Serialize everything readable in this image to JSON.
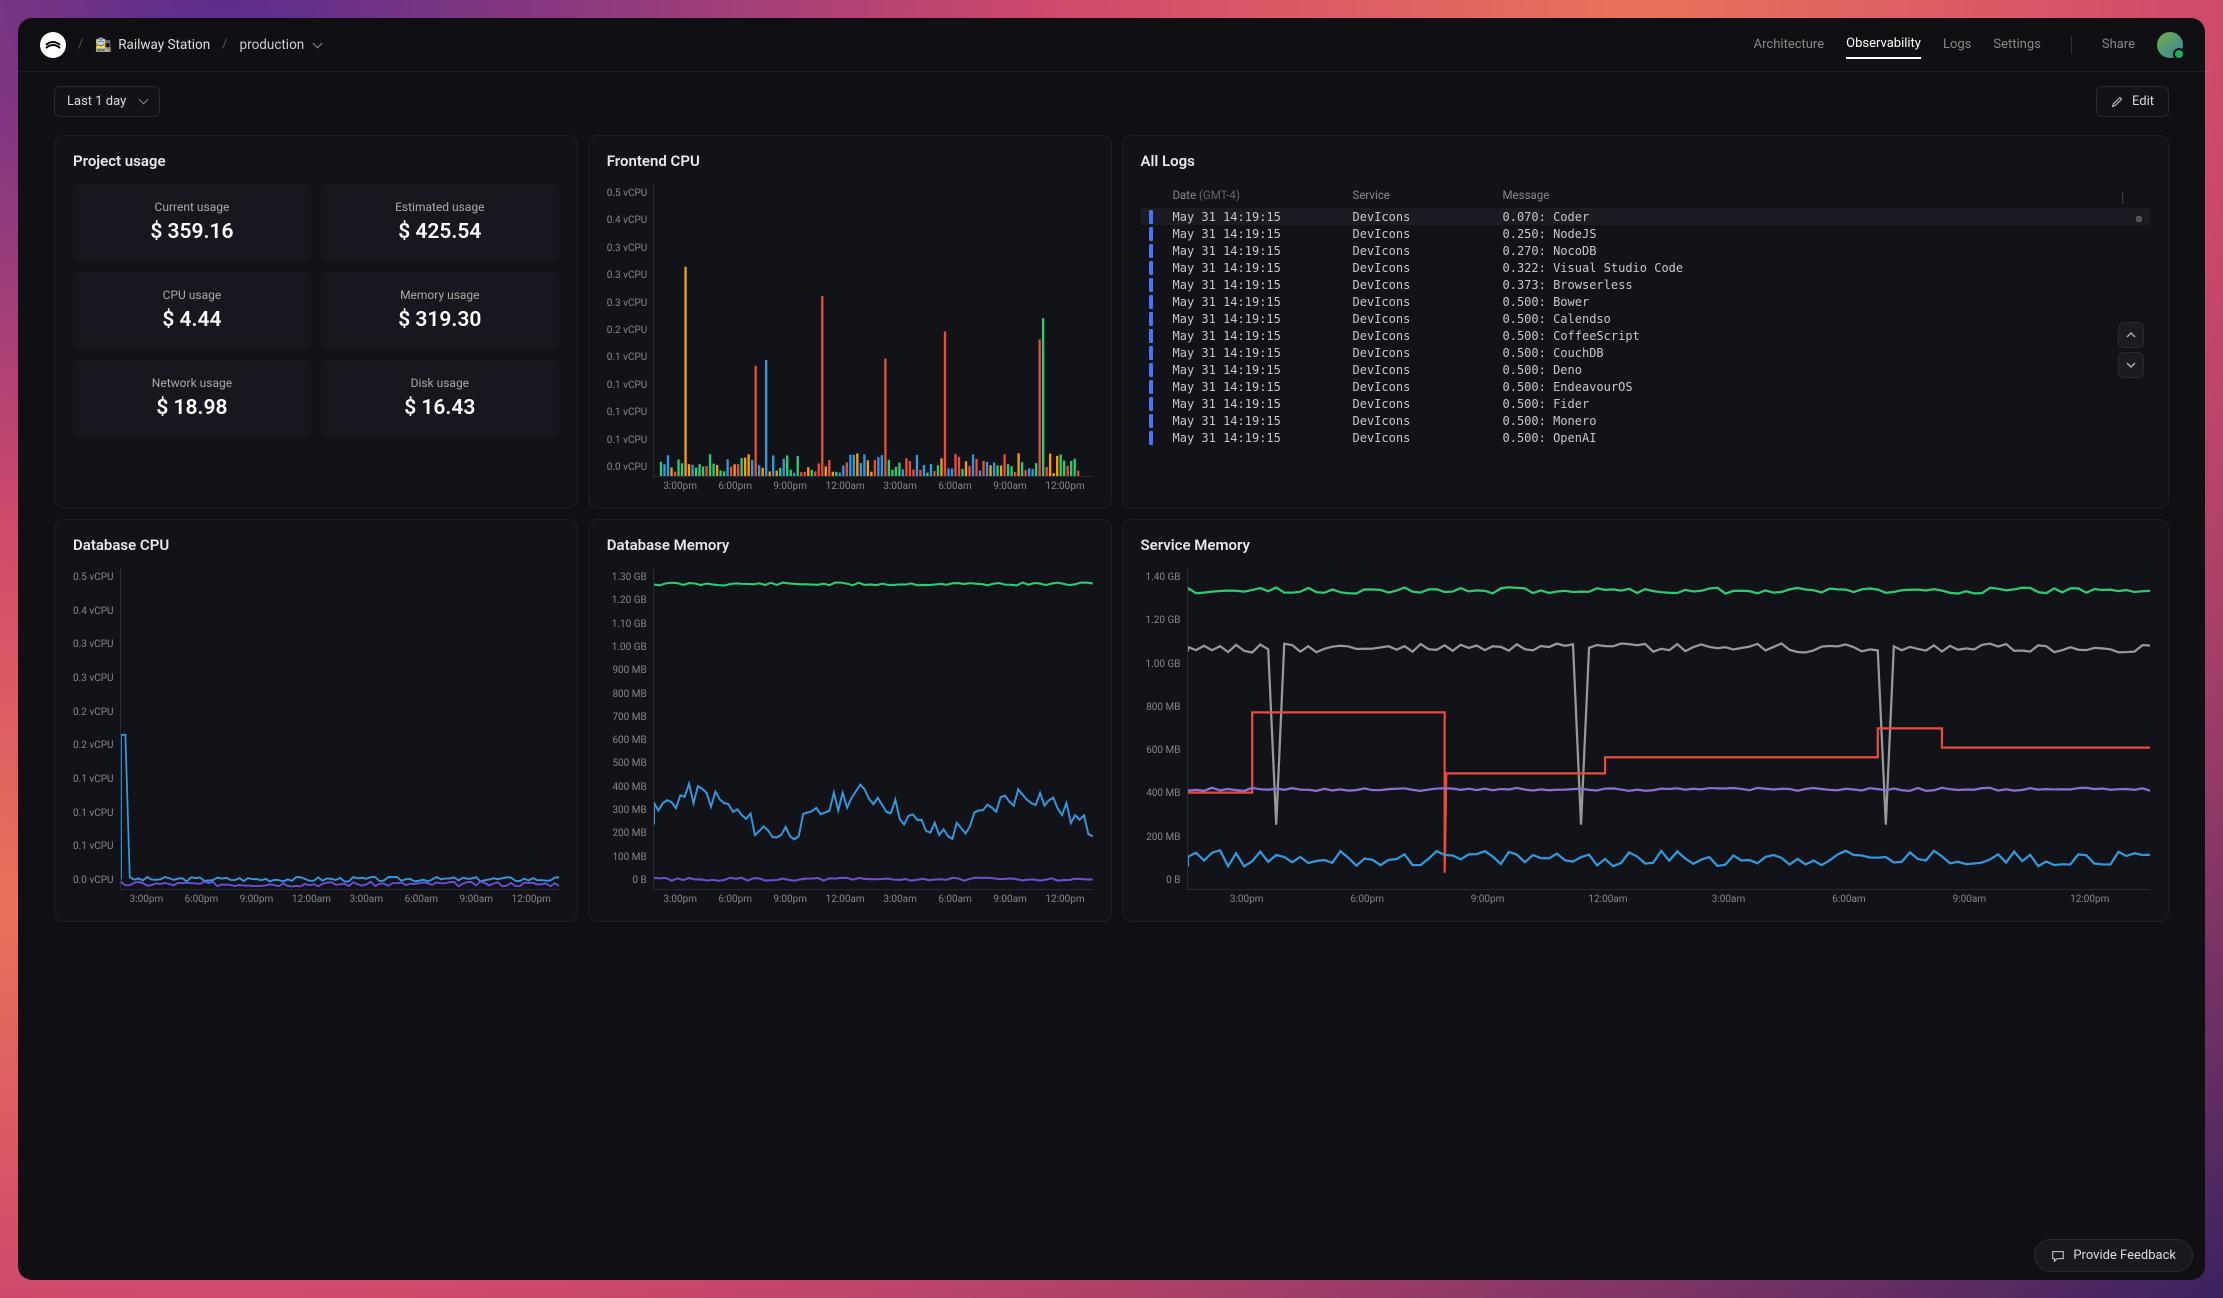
{
  "header": {
    "project_emoji": "🚉",
    "project_name": "Railway Station",
    "environment": "production",
    "tabs": [
      "Architecture",
      "Observability",
      "Logs",
      "Settings"
    ],
    "active_tab": "Observability",
    "share_label": "Share"
  },
  "toolbar": {
    "time_range": "Last 1 day",
    "edit_label": "Edit"
  },
  "panels": {
    "project_usage": {
      "title": "Project usage",
      "cards": [
        {
          "label": "Current usage",
          "value": "$ 359.16"
        },
        {
          "label": "Estimated usage",
          "value": "$ 425.54"
        },
        {
          "label": "CPU usage",
          "value": "$ 4.44"
        },
        {
          "label": "Memory usage",
          "value": "$ 319.30"
        },
        {
          "label": "Network usage",
          "value": "$ 18.98"
        },
        {
          "label": "Disk usage",
          "value": "$ 16.43"
        }
      ]
    },
    "frontend_cpu": {
      "title": "Frontend CPU"
    },
    "all_logs": {
      "title": "All Logs",
      "columns": {
        "date": "Date",
        "tz": "(GMT-4)",
        "service": "Service",
        "message": "Message"
      },
      "rows": [
        {
          "date": "May 31 14:19:15",
          "service": "DevIcons",
          "msg": "0.070: Coder"
        },
        {
          "date": "May 31 14:19:15",
          "service": "DevIcons",
          "msg": "0.250: NodeJS"
        },
        {
          "date": "May 31 14:19:15",
          "service": "DevIcons",
          "msg": "0.270: NocoDB"
        },
        {
          "date": "May 31 14:19:15",
          "service": "DevIcons",
          "msg": "0.322: Visual Studio Code"
        },
        {
          "date": "May 31 14:19:15",
          "service": "DevIcons",
          "msg": "0.373: Browserless"
        },
        {
          "date": "May 31 14:19:15",
          "service": "DevIcons",
          "msg": "0.500: Bower"
        },
        {
          "date": "May 31 14:19:15",
          "service": "DevIcons",
          "msg": "0.500: Calendso"
        },
        {
          "date": "May 31 14:19:15",
          "service": "DevIcons",
          "msg": "0.500: CoffeeScript"
        },
        {
          "date": "May 31 14:19:15",
          "service": "DevIcons",
          "msg": "0.500: CouchDB"
        },
        {
          "date": "May 31 14:19:15",
          "service": "DevIcons",
          "msg": "0.500: Deno"
        },
        {
          "date": "May 31 14:19:15",
          "service": "DevIcons",
          "msg": "0.500: EndeavourOS"
        },
        {
          "date": "May 31 14:19:15",
          "service": "DevIcons",
          "msg": "0.500: Fider"
        },
        {
          "date": "May 31 14:19:15",
          "service": "DevIcons",
          "msg": "0.500: Monero"
        },
        {
          "date": "May 31 14:19:15",
          "service": "DevIcons",
          "msg": "0.500: OpenAI"
        }
      ]
    },
    "database_cpu": {
      "title": "Database CPU"
    },
    "database_memory": {
      "title": "Database Memory"
    },
    "service_memory": {
      "title": "Service Memory"
    }
  },
  "feedback_label": "Provide Feedback",
  "chart_data": [
    {
      "id": "frontend_cpu",
      "type": "bar",
      "title": "Frontend CPU",
      "ylabel": "vCPU",
      "ylim": [
        0,
        0.5
      ],
      "yticks": [
        "0.5 vCPU",
        "0.4 vCPU",
        "0.3 vCPU",
        "0.3 vCPU",
        "0.3 vCPU",
        "0.2 vCPU",
        "0.1 vCPU",
        "0.1 vCPU",
        "0.1 vCPU",
        "0.1 vCPU",
        "0.0 vCPU"
      ],
      "xticks": [
        "3:00pm",
        "6:00pm",
        "9:00pm",
        "12:00am",
        "3:00am",
        "6:00am",
        "9:00am",
        "12:00pm"
      ],
      "series_colors": [
        "#2ecc71",
        "#e74c3c",
        "#3498db",
        "#f39c12"
      ]
    },
    {
      "id": "database_cpu",
      "type": "line",
      "title": "Database CPU",
      "ylabel": "vCPU",
      "ylim": [
        0,
        0.5
      ],
      "yticks": [
        "0.5 vCPU",
        "0.4 vCPU",
        "0.3 vCPU",
        "0.3 vCPU",
        "0.2 vCPU",
        "0.2 vCPU",
        "0.1 vCPU",
        "0.1 vCPU",
        "0.1 vCPU",
        "0.0 vCPU"
      ],
      "xticks": [
        "3:00pm",
        "6:00pm",
        "9:00pm",
        "12:00am",
        "3:00am",
        "6:00am",
        "9:00am",
        "12:00pm"
      ],
      "series_colors": [
        "#3498db",
        "#6b4ed1"
      ]
    },
    {
      "id": "database_memory",
      "type": "line",
      "title": "Database Memory",
      "ylabel": "",
      "ylim": [
        0,
        1400
      ],
      "yticks": [
        "1.30 GB",
        "1.20 GB",
        "1.10 GB",
        "1.00 GB",
        "900 MB",
        "800 MB",
        "700 MB",
        "600 MB",
        "500 MB",
        "400 MB",
        "300 MB",
        "200 MB",
        "100 MB",
        "0 B"
      ],
      "xticks": [
        "3:00pm",
        "6:00pm",
        "9:00pm",
        "12:00am",
        "3:00am",
        "6:00am",
        "9:00am",
        "12:00pm"
      ],
      "series": [
        {
          "name": "s1",
          "color": "#2ecc71",
          "approx": "~1.28 GB flat"
        },
        {
          "name": "s2",
          "color": "#3498db",
          "approx": "~200–320 MB varying"
        },
        {
          "name": "s3",
          "color": "#6b4ed1",
          "approx": "~20–40 MB flat"
        }
      ]
    },
    {
      "id": "service_memory",
      "type": "line",
      "title": "Service Memory",
      "ylabel": "",
      "ylim": [
        0,
        1500
      ],
      "yticks": [
        "1.40 GB",
        "1.20 GB",
        "1.00 GB",
        "800 MB",
        "600 MB",
        "400 MB",
        "200 MB",
        "0 B"
      ],
      "xticks": [
        "3:00pm",
        "6:00pm",
        "9:00pm",
        "12:00am",
        "3:00am",
        "6:00am",
        "9:00am",
        "12:00pm"
      ],
      "series": [
        {
          "name": "green",
          "color": "#2ecc71",
          "approx": "~1.38 GB flat"
        },
        {
          "name": "gray",
          "color": "#888",
          "approx": "~1.00–1.05 GB"
        },
        {
          "name": "red",
          "color": "#e74c3c",
          "approx": "steps 500→700→620 MB"
        },
        {
          "name": "purple",
          "color": "#8b6fd4",
          "approx": "~400 MB flat"
        },
        {
          "name": "blue",
          "color": "#3498db",
          "approx": "~120–170 MB"
        }
      ]
    }
  ]
}
